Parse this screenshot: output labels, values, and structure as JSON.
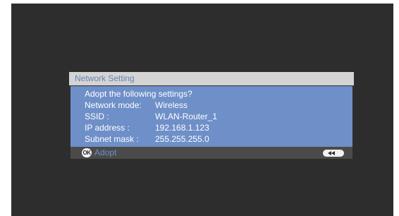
{
  "dialog": {
    "title": "Network Setting",
    "prompt": "Adopt the following settings?",
    "fields": [
      {
        "label": "Network mode:",
        "value": "Wireless"
      },
      {
        "label": "SSID :",
        "value": "WLAN-Router_1"
      },
      {
        "label": "IP address :",
        "value": "192.168.1.123"
      },
      {
        "label": "Subnet mask :",
        "value": "255.255.255.0"
      }
    ]
  },
  "footer": {
    "ok_icon_text": "OK",
    "adopt_label": "Adopt",
    "back_icon": "rewind-icon"
  },
  "colors": {
    "screen_bg": "#2e2d2d",
    "title_bg": "#d4d4d4",
    "title_text": "#6a82b4",
    "body_bg": "#6e8fc8",
    "footer_bg": "#4b4a4a"
  }
}
